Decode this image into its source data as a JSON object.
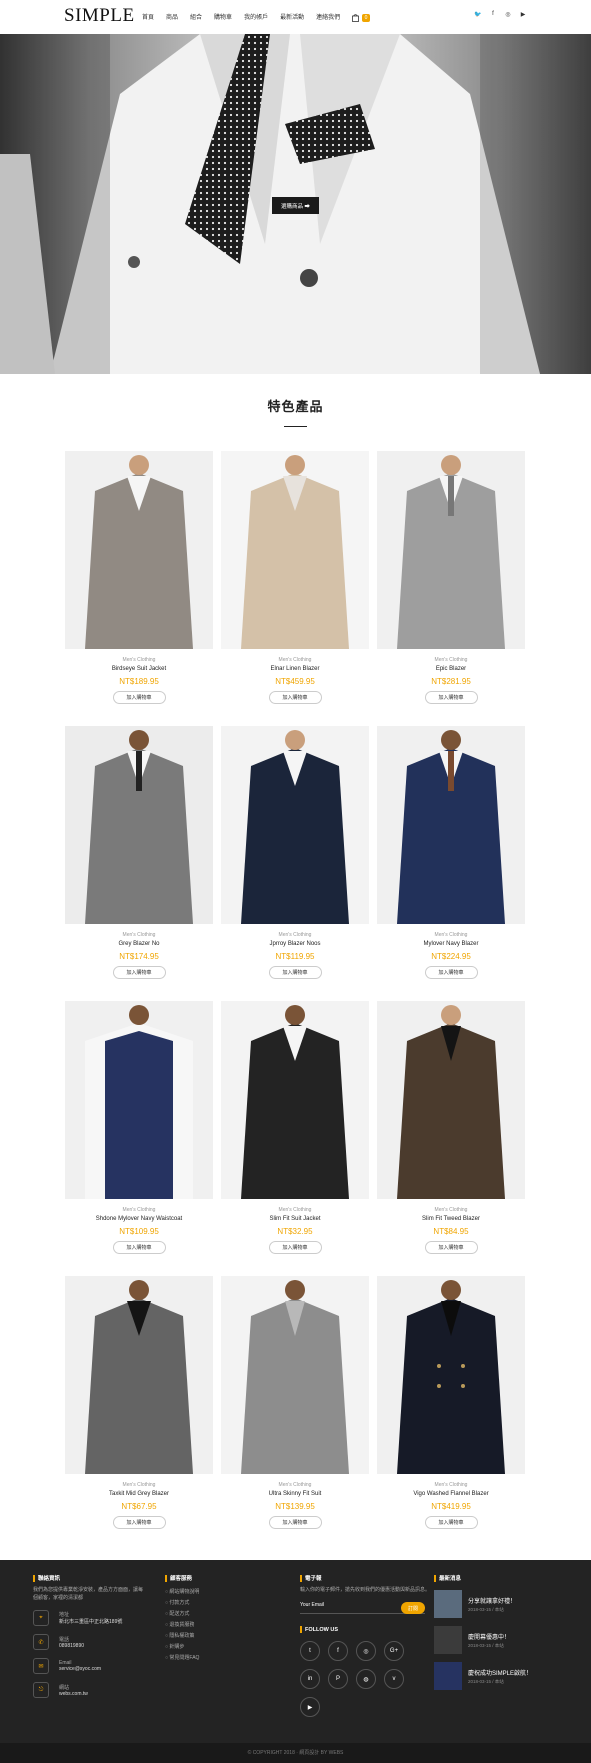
{
  "header": {
    "logo": "SIMPLE",
    "nav": [
      "首頁",
      "商品",
      "組合",
      "購物車",
      "我的帳戶",
      "最新活動",
      "連絡我們"
    ],
    "cart_count": "0",
    "social": [
      "twitter",
      "facebook",
      "instagram",
      "youtube"
    ]
  },
  "hero": {
    "button_label": "選購商品 ➡"
  },
  "featured": {
    "title": "特色產品",
    "products": [
      {
        "category": "Men's Clothing",
        "name": "Birdseye Suit Jacket",
        "price": "NT$189.95",
        "button": "加入購物車",
        "bg": "#918a83"
      },
      {
        "category": "Men's Clothing",
        "name": "Elnar Linen Blazer",
        "price": "NT$459.95",
        "button": "加入購物車",
        "bg": "#d4c1a8"
      },
      {
        "category": "Men's Clothing",
        "name": "Epic Blazer",
        "price": "NT$281.95",
        "button": "加入購物車",
        "bg": "#9e9e9e"
      },
      {
        "category": "Men's Clothing",
        "name": "Grey Blazer No",
        "price": "NT$174.95",
        "button": "加入購物車",
        "bg": "#7a7a7a"
      },
      {
        "category": "Men's Clothing",
        "name": "Jprroy Blazer Noos",
        "price": "NT$119.95",
        "button": "加入購物車",
        "bg": "#1b253a"
      },
      {
        "category": "Men's Clothing",
        "name": "Mylover Navy Blazer",
        "price": "NT$224.95",
        "button": "加入購物車",
        "bg": "#22315a"
      },
      {
        "category": "Men's Clothing",
        "name": "Shdone Mylover Navy Waistcoat",
        "price": "NT$109.95",
        "button": "加入購物車",
        "bg": "#263361"
      },
      {
        "category": "Men's Clothing",
        "name": "Slim Fit Suit Jacket",
        "price": "NT$32.95",
        "button": "加入購物車",
        "bg": "#232323"
      },
      {
        "category": "Men's Clothing",
        "name": "Slim Fit Tweed Blazer",
        "price": "NT$84.95",
        "button": "加入購物車",
        "bg": "#4b3b2d"
      },
      {
        "category": "Men's Clothing",
        "name": "Taxkit Mid Grey Blazer",
        "price": "NT$67.95",
        "button": "加入購物車",
        "bg": "#646464"
      },
      {
        "category": "Men's Clothing",
        "name": "Ultra Skinny Fit Suit",
        "price": "NT$139.95",
        "button": "加入購物車",
        "bg": "#8d8d8d"
      },
      {
        "category": "Men's Clothing",
        "name": "Vigo Washed Flannel Blazer",
        "price": "NT$419.95",
        "button": "加入購物車",
        "bg": "#161a27"
      }
    ]
  },
  "footer": {
    "contact_title": "聯絡資訊",
    "contact_text": "我們為您提供專業乾淨安裝，產品方方面面，讓每個顧客，家裡的清潔都",
    "address_label": "地址",
    "address": "新北市三重區中正北路189號",
    "phone_label": "電話",
    "phone": "089819890",
    "email_label": "Email",
    "email": "service@syoc.com",
    "site_label": "網站",
    "site": "webs.com.tw",
    "service_title": "顧客服務",
    "service_links": [
      "網站購物說明",
      "付款方式",
      "配送方式",
      "退換貨服務",
      "隱私權政策",
      "針購步",
      "常見問題FAQ"
    ],
    "newsletter_title": "電子報",
    "newsletter_text": "輸入你的電子郵件，搶先收到我們的優惠活動與新品訊息。",
    "email_placeholder": "Your Email",
    "subscribe_label": "訂閱",
    "follow_title": "FOLLOW US",
    "follow_icons": [
      "t",
      "f",
      "ig",
      "G+",
      "in",
      "p",
      "dr",
      "v",
      "yt"
    ],
    "news_title": "最新消息",
    "news": [
      {
        "title": "分享就讓拿好禮！",
        "date": "2018-03-15 / 本站"
      },
      {
        "title": "慶開幕優惠中！",
        "date": "2018-03-15 / 本站"
      },
      {
        "title": "慶祝成功SIMPLE啟航！",
        "date": "2018-03-15 / 本站"
      }
    ],
    "copyright": "© COPYRIGHT 2018 · 網頁設計 BY WEBS"
  }
}
